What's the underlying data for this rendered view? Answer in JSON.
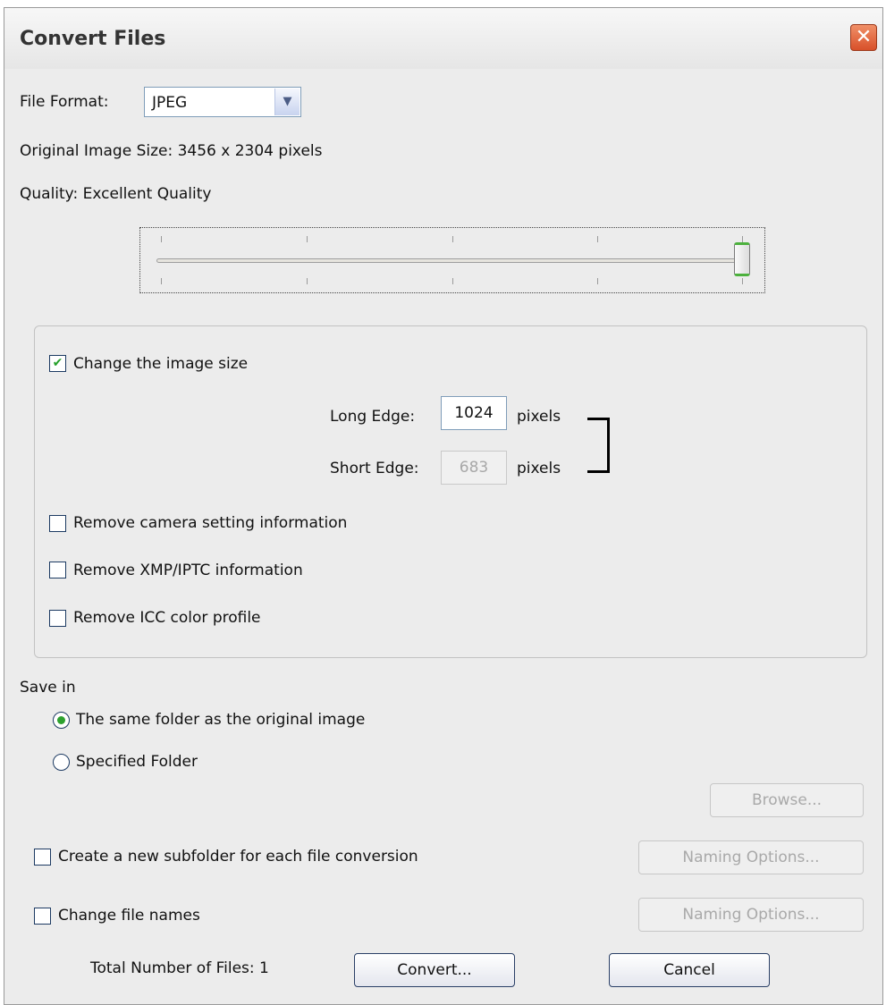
{
  "title": "Convert Files",
  "close_glyph": "✕",
  "file_format": {
    "label": "File Format:",
    "value": "JPEG",
    "arrow_glyph": "▼"
  },
  "original_size": "Original Image Size: 3456 x 2304 pixels",
  "quality": {
    "label": "Quality: Excellent Quality",
    "slider_fraction": 1.0
  },
  "resize": {
    "enabled": true,
    "check_glyph": "✔",
    "label": "Change the image size",
    "long_edge_label": "Long Edge:",
    "long_edge_value": "1024",
    "short_edge_label": "Short Edge:",
    "short_edge_value": "683",
    "unit": "pixels"
  },
  "remove_options": [
    {
      "label": "Remove camera setting information",
      "checked": false
    },
    {
      "label": "Remove XMP/IPTC information",
      "checked": false
    },
    {
      "label": "Remove ICC color profile",
      "checked": false
    }
  ],
  "save_in": {
    "label": "Save in",
    "options": [
      {
        "label": "The same folder as the original image",
        "selected": true
      },
      {
        "label": "Specified Folder",
        "selected": false
      }
    ],
    "browse_label": "Browse..."
  },
  "subfolder": {
    "label": "Create a new subfolder for each file conversion",
    "checked": false,
    "button_label": "Naming Options..."
  },
  "change_names": {
    "label": "Change file names",
    "checked": false,
    "button_label": "Naming Options..."
  },
  "footer": {
    "total_files": "Total Number of Files: 1",
    "convert_label": "Convert...",
    "cancel_label": "Cancel"
  },
  "colors": {
    "accent_green": "#2da12f",
    "close_red": "#d8502a"
  }
}
